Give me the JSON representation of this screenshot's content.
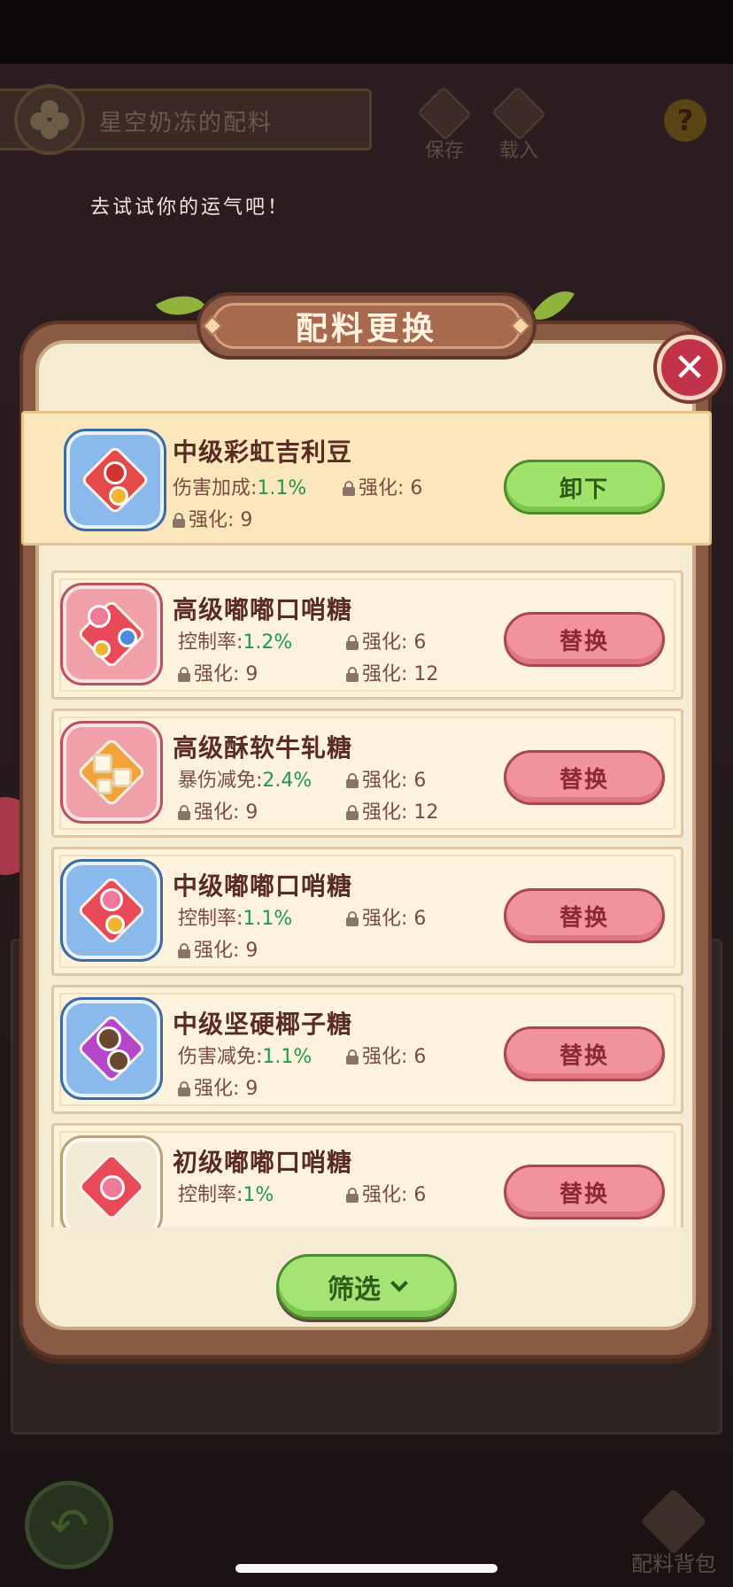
{
  "background": {
    "title": "星空奶冻的配料",
    "save_label": "保存",
    "load_label": "载入",
    "help_label": "?",
    "tip": "去试试你的运气吧！",
    "bag_label": "配料背包"
  },
  "popup": {
    "title": "配料更换",
    "close_label": "✕",
    "equipped": {
      "name": "中级彩虹吉利豆",
      "stat_label": "伤害加成:",
      "stat_value": "1.1%",
      "locks": [
        "强化: 6",
        "强化: 9"
      ],
      "button_label": "卸下"
    },
    "items": [
      {
        "name": "高级嘟嘟口哨糖",
        "stat_label": "控制率:",
        "stat_value": "1.2%",
        "locks": [
          "强化: 6",
          "强化: 9",
          "强化: 12"
        ],
        "button_label": "替换"
      },
      {
        "name": "高级酥软牛轧糖",
        "stat_label": "暴伤减免:",
        "stat_value": "2.4%",
        "locks": [
          "强化: 6",
          "强化: 9",
          "强化: 12"
        ],
        "button_label": "替换"
      },
      {
        "name": "中级嘟嘟口哨糖",
        "stat_label": "控制率:",
        "stat_value": "1.1%",
        "locks": [
          "强化: 6",
          "强化: 9"
        ],
        "button_label": "替换"
      },
      {
        "name": "中级坚硬椰子糖",
        "stat_label": "伤害减免:",
        "stat_value": "1.1%",
        "locks": [
          "强化: 6",
          "强化: 9"
        ],
        "button_label": "替换"
      },
      {
        "name": "初级嘟嘟口哨糖",
        "stat_label": "控制率:",
        "stat_value": "1%",
        "locks": [
          "强化: 6"
        ],
        "button_label": "替换"
      }
    ],
    "filter_label": "筛选"
  },
  "colors": {
    "stat_value": "#1d9a4f",
    "replace_button": "#f0939a",
    "unequip_button": "#9fe26c",
    "filter_button": "#a4e475",
    "close_button": "#c2334a"
  }
}
